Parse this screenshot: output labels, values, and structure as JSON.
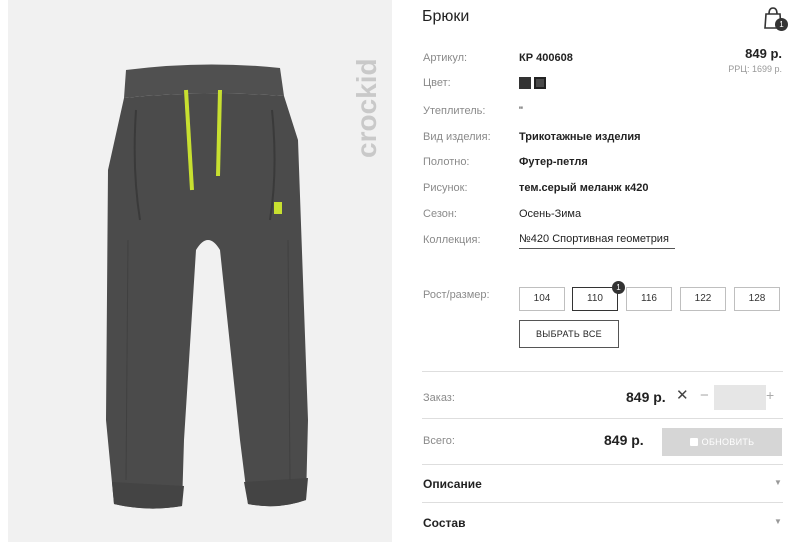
{
  "product": {
    "title": "Брюки",
    "brand": "crockid",
    "price": "849 р.",
    "rrp": "РРЦ: 1699 р."
  },
  "cart": {
    "icon": "shopping-bag-icon",
    "count": "1"
  },
  "details": [
    {
      "label": "Артикул:",
      "value": "КР 400608",
      "bold": true
    },
    {
      "label": "Цвет:",
      "value": "",
      "bold": false
    },
    {
      "label": "Утеплитель:",
      "value": "\"",
      "bold": false
    },
    {
      "label": "Вид изделия:",
      "value": "Трикотажные изделия",
      "bold": true
    },
    {
      "label": "Полотно:",
      "value": "Футер-петля",
      "bold": true
    },
    {
      "label": "Рисунок:",
      "value": "тем.серый меланж к420",
      "bold": true
    },
    {
      "label": "Сезон:",
      "value": "Осень-Зима",
      "bold": false
    },
    {
      "label": "Коллекция:",
      "value": "№420 Спортивная геометрия",
      "bold": false
    }
  ],
  "color_swatches": [
    "#333333",
    "#4a4a4a"
  ],
  "sizes": {
    "label": "Рост/размер:",
    "options": [
      "104",
      "110",
      "116",
      "122",
      "128"
    ],
    "selected": "110",
    "selected_count": "1",
    "select_all": "ВЫБРАТЬ ВСЕ"
  },
  "order": {
    "label": "Заказ:",
    "price": "849 р.",
    "remove_icon": "close-icon",
    "minus": "−",
    "plus": "+",
    "quantity": ""
  },
  "total": {
    "label": "Всего:",
    "price": "849 р.",
    "update_button": "ОБНОВИТЬ",
    "update_icon": "cart-icon"
  },
  "accordions": [
    {
      "label": "Описание"
    },
    {
      "label": "Состав"
    }
  ],
  "colors": {
    "accent_lace": "#c8e030",
    "fabric": "#4b4b4b",
    "disabled_button": "#d6d6d6"
  }
}
